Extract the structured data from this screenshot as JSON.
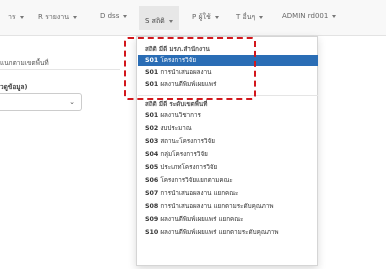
{
  "navbar": {
    "items": [
      {
        "label": "าร"
      },
      {
        "label": "R รายงาน"
      },
      {
        "label": "D dss"
      },
      {
        "label": "S สถิติ"
      },
      {
        "label": "P ผู้ใช้"
      },
      {
        "label": "T อื่นๆ"
      },
      {
        "label": "ADMIN rd001"
      }
    ],
    "active_index": 3
  },
  "content": {
    "section_label": "แนกตามเขตพื้นที่",
    "field_label": "วดูข้อมูล)",
    "select_value": ""
  },
  "dropdown": {
    "group1": {
      "header": "สถิติ มีดี มรภ.สำนักงาน",
      "items": [
        {
          "code": "S01",
          "text": "โครงการวิจัย"
        },
        {
          "code": "S01",
          "text": "การนำเสนอผลงาน"
        },
        {
          "code": "S01",
          "text": "ผลงานตีพิมพ์เผยแพร่"
        }
      ]
    },
    "group2": {
      "header": "สถิติ มีดี ระดับเขตพื้นที่",
      "items": [
        {
          "code": "S01",
          "text": "ผลงานวิชาการ"
        },
        {
          "code": "S02",
          "text": "งบประมาณ"
        },
        {
          "code": "S03",
          "text": "สถานะโครงการวิจัย"
        },
        {
          "code": "S04",
          "text": "กลุ่มโครงการวิจัย"
        },
        {
          "code": "S05",
          "text": "ประเภทโครงการวิจัย"
        },
        {
          "code": "S06",
          "text": "โครงการวิจัยแยกตามคณะ"
        },
        {
          "code": "S07",
          "text": "การนำเสนอผลงาน แยกคณะ"
        },
        {
          "code": "S08",
          "text": "การนำเสนอผลงาน แยกตามระดับคุณภาพ"
        },
        {
          "code": "S09",
          "text": "ผลงานตีพิมพ์เผยแพร่ แยกคณะ"
        },
        {
          "code": "S10",
          "text": "ผลงานตีพิมพ์เผยแพร่ แยกตามระดับคุณภาพ"
        }
      ]
    },
    "highlight_color": "#2a6db5",
    "annotation_color": "#d2171c"
  }
}
